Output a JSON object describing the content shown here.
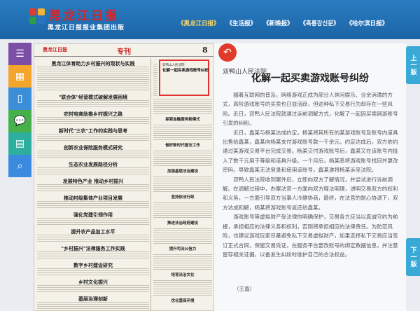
{
  "header": {
    "logo_title": "黑龙江日报",
    "logo_subtitle": "黑龙江日报报业集团出版",
    "publications": [
      {
        "label": "《黑龙江日报》",
        "active": true
      },
      {
        "label": "《生活报》",
        "active": false
      },
      {
        "label": "《新晚报》",
        "active": false
      },
      {
        "label": "《흑룡강신문》",
        "active": false
      },
      {
        "label": "《哈尔滨日报》",
        "active": false
      }
    ],
    "logo_colors": [
      "#e23b2e",
      "#f2b233",
      "#2b9d46",
      "#2a72c6"
    ]
  },
  "toolbar": [
    {
      "name": "menu-icon",
      "glyph": "☰",
      "color": "#7b4fa5"
    },
    {
      "name": "grid-icon",
      "glyph": "▦",
      "color": "#f3a52c"
    },
    {
      "name": "phone-icon",
      "glyph": "▯",
      "color": "#3b8fd8"
    },
    {
      "name": "chat-icon",
      "glyph": "💬",
      "color": "#46b04a"
    },
    {
      "name": "doc-icon",
      "glyph": "▤",
      "color": "#2eaf9e"
    },
    {
      "name": "search-icon",
      "glyph": "⌕",
      "color": "#3a8be0"
    }
  ],
  "paper": {
    "masthead": "黑龙江日报",
    "section": "专刊",
    "page_number": "8",
    "highlight_label": "双鸭山人民法院",
    "highlight_title": "化解一起买卖游戏账号纠纷",
    "headlines": [
      "黑龙江体育助力乡村振兴的现状与实践",
      "\"联合体\"经营模式破解发展困境",
      "农村电商助推乡村振兴之路",
      "新时代\"三农\"工作的实践与思考",
      "创新农业保险服务模式研究",
      "生态农业发展路径分析",
      "发展特色产业 推动乡村振兴",
      "推动村级集体产业项目发展",
      "强化党建引领作用",
      "提升农产品加工水平",
      "\"乡村振兴\"法律服务工作实践",
      "数字乡村建设研究",
      "乡村文化振兴",
      "基层治理创新"
    ],
    "right_headlines": [
      "探索金融服务新模式",
      "做好新时代普法工作",
      "加强基层法治建设",
      "坚持依法行政",
      "推进法治政府建设",
      "提升司法公信力",
      "培育法治文化",
      "优化营商环境"
    ]
  },
  "article": {
    "author": "双鸭山人民法院",
    "title": "化解一起买卖游戏账号纠纷",
    "paragraphs": [
      "随着互联网的普及，网络游戏正成为部分人休闲娱乐、业余消遣的方式，高阶游戏账号的买卖也日益活跃，但这种私下交易行为却存在一些风险。近日，双鸭人民法院就通过诉前调解方式，化解了一起因买卖网游账号引发的纠纷。",
      "近日，鑫某与杨某达成约定，杨某将其所有的某游戏账号及账号内道具出售给鑫某，鑫某向杨某支付游戏账号款一千余元。约定达成后，双方依约通过某游戏交易平台完成交易。杨某交付游戏账号后，鑫某又在该账号内投入了数千元用于等级和道具升级。一个月后，杨某悉将游戏账号找回并更改密码，导致鑫某无法登录和使用该账号，鑫某遂将杨某诉至法院。",
      "双鸭人民法院收到案件后，立即向双方了解情况，并尝试进行诉前调解。在调解过程中，办案法官一方面向双方释法明理，讲明交易双方的权利和义务，一方面引导双方当事人冷静协商，最终，在法官的耐心协调下，双方达成和解，杨某将游戏账号返还给鑫某。",
      "游戏账号等虚拟财产受法律的明确保护，交易各方应当以真诚守约为前提，承担相应的法律义务和权利，否则将承担相应的法律责任。为防范风险，也建议游戏玩家尽量避免私下交易虚拟财产，如果选择私下交易应当签订正式合同，保留交易凭证，在服务平台更改账号的绑定数据信息，并注意留存相关证据，以备发生纠纷时维护自己的合法权益。"
    ],
    "signature": "（王鑫）"
  },
  "side_tabs": {
    "prev": "上一版",
    "next": "下一版"
  }
}
